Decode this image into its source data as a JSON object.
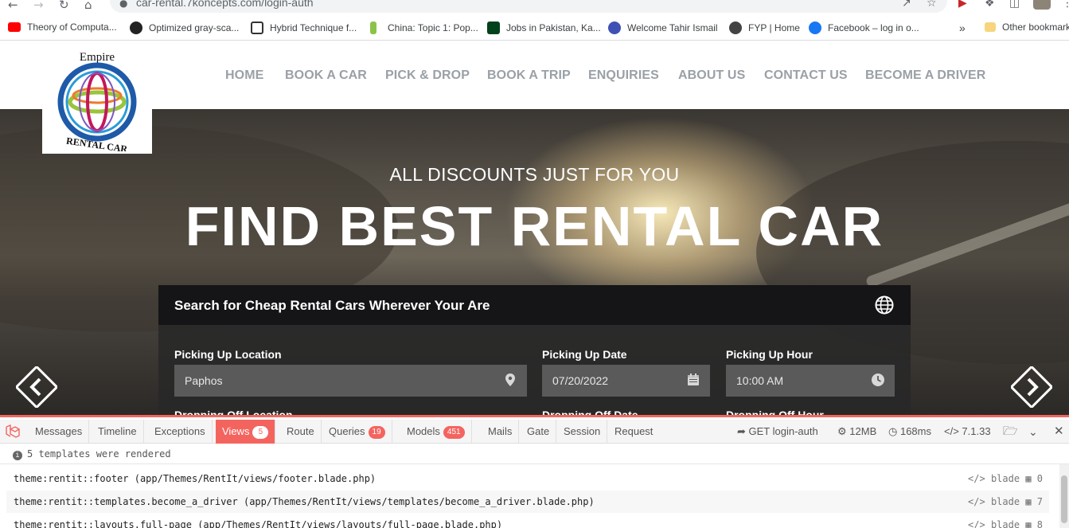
{
  "browser": {
    "url": "car-rental.7koncepts.com/login-auth",
    "bookmarks": [
      {
        "label": "Theory of Computa...",
        "color": "#ff0000"
      },
      {
        "label": "Optimized gray-sca...",
        "color": "#222222"
      },
      {
        "label": "Hybrid Technique f...",
        "color": "#333333"
      },
      {
        "label": "China: Topic 1: Pop...",
        "color": "#8bc34a"
      },
      {
        "label": "Jobs in Pakistan, Ka...",
        "color": "#01411c"
      },
      {
        "label": "Welcome Tahir Ismail",
        "color": "#3f51b5"
      },
      {
        "label": "FYP | Home",
        "color": "#444444"
      },
      {
        "label": "Facebook – log in o...",
        "color": "#1877f2"
      }
    ],
    "bookmarks_overflow": "»",
    "other_bookmarks": "Other bookmarks"
  },
  "site": {
    "logo": {
      "top_text": "Empire",
      "bottom_text": "RENTAL CAR"
    },
    "menu": [
      "HOME",
      "BOOK A CAR",
      "PICK & DROP",
      "BOOK A TRIP",
      "ENQUIRIES",
      "ABOUT US",
      "CONTACT US",
      "BECOME A DRIVER"
    ]
  },
  "hero": {
    "subtitle": "ALL DISCOUNTS JUST FOR YOU",
    "title": "FIND BEST RENTAL CAR",
    "search": {
      "title": "Search for Cheap Rental Cars Wherever Your Are",
      "pickup_location_label": "Picking Up Location",
      "pickup_location_value": "Paphos",
      "pickup_date_label": "Picking Up Date",
      "pickup_date_value": "07/20/2022",
      "pickup_hour_label": "Picking Up Hour",
      "pickup_hour_value": "10:00 AM",
      "dropoff_location_label": "Dropping Off Location",
      "dropoff_date_label": "Dropping Off Date",
      "dropoff_hour_label": "Dropping Off Hour"
    }
  },
  "debugbar": {
    "tabs": [
      {
        "label": "Messages"
      },
      {
        "label": "Timeline"
      },
      {
        "label": "Exceptions"
      },
      {
        "label": "Views",
        "badge": "5",
        "active": true
      },
      {
        "label": "Route"
      },
      {
        "label": "Queries",
        "badge": "19"
      },
      {
        "label": "Models",
        "badge": "451"
      },
      {
        "label": "Mails"
      },
      {
        "label": "Gate"
      },
      {
        "label": "Session"
      },
      {
        "label": "Request"
      }
    ],
    "route": "GET login-auth",
    "memory": "12MB",
    "time": "168ms",
    "php_version": "7.1.33",
    "status": "5 templates were rendered",
    "views": [
      {
        "name": "theme:rentit::footer (app/Themes/RentIt/views/footer.blade.php)",
        "type": "blade",
        "params": "0"
      },
      {
        "name": "theme:rentit::templates.become_a_driver (app/Themes/RentIt/views/templates/become_a_driver.blade.php)",
        "type": "blade",
        "params": "7"
      },
      {
        "name": "theme:rentit::layouts.full-page (app/Themes/RentIt/views/layouts/full-page.blade.php)",
        "type": "blade",
        "params": "8"
      }
    ],
    "accent_color": "#f4645f"
  }
}
